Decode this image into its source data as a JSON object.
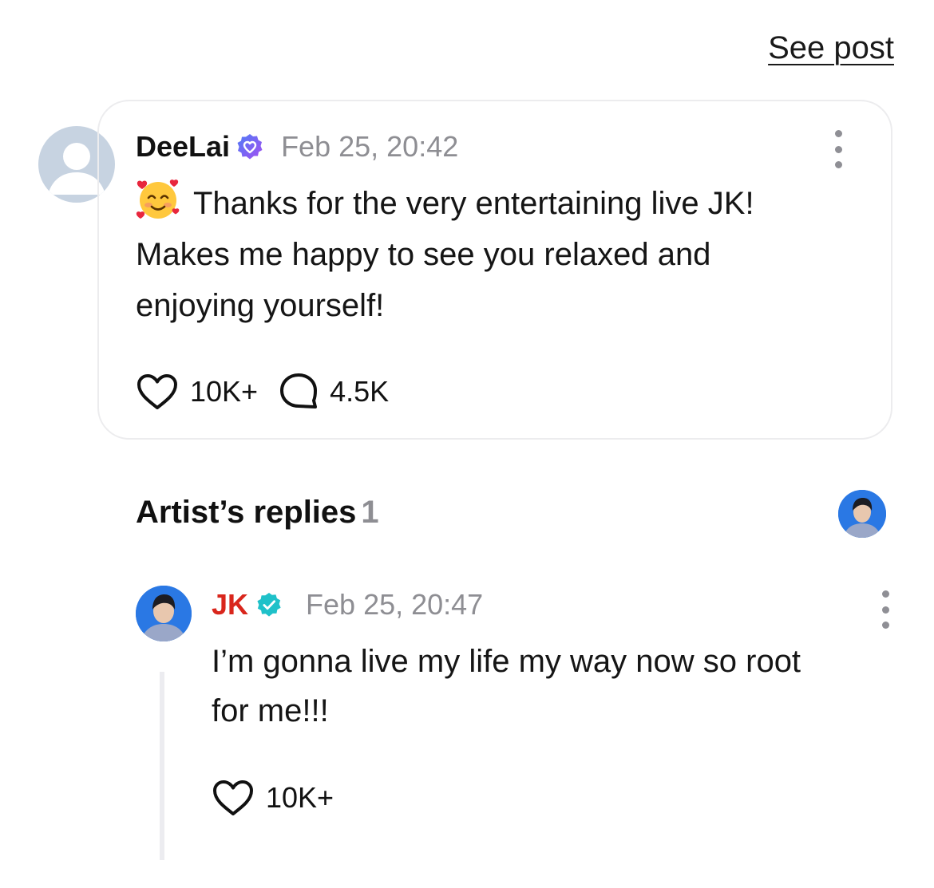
{
  "header": {
    "see_post_label": "See post"
  },
  "post": {
    "author": "DeeLai",
    "timestamp": "Feb 25, 20:42",
    "text_line1": "Thanks for the very entertaining live JK!",
    "text_line2": "Makes me happy to see you relaxed and",
    "text_line3": "enjoying yourself!",
    "likes": "10K+",
    "comments": "4.5K",
    "badge_color": "#7b5cf0"
  },
  "artist_replies": {
    "title": "Artist’s replies",
    "count": "1"
  },
  "reply": {
    "author": "JK",
    "author_color": "#d9261c",
    "badge_color": "#1fc1c9",
    "timestamp": "Feb 25, 20:47",
    "text_line1": "I’m gonna live my life my way now so root",
    "text_line2": "for me!!!",
    "likes": "10K+"
  }
}
